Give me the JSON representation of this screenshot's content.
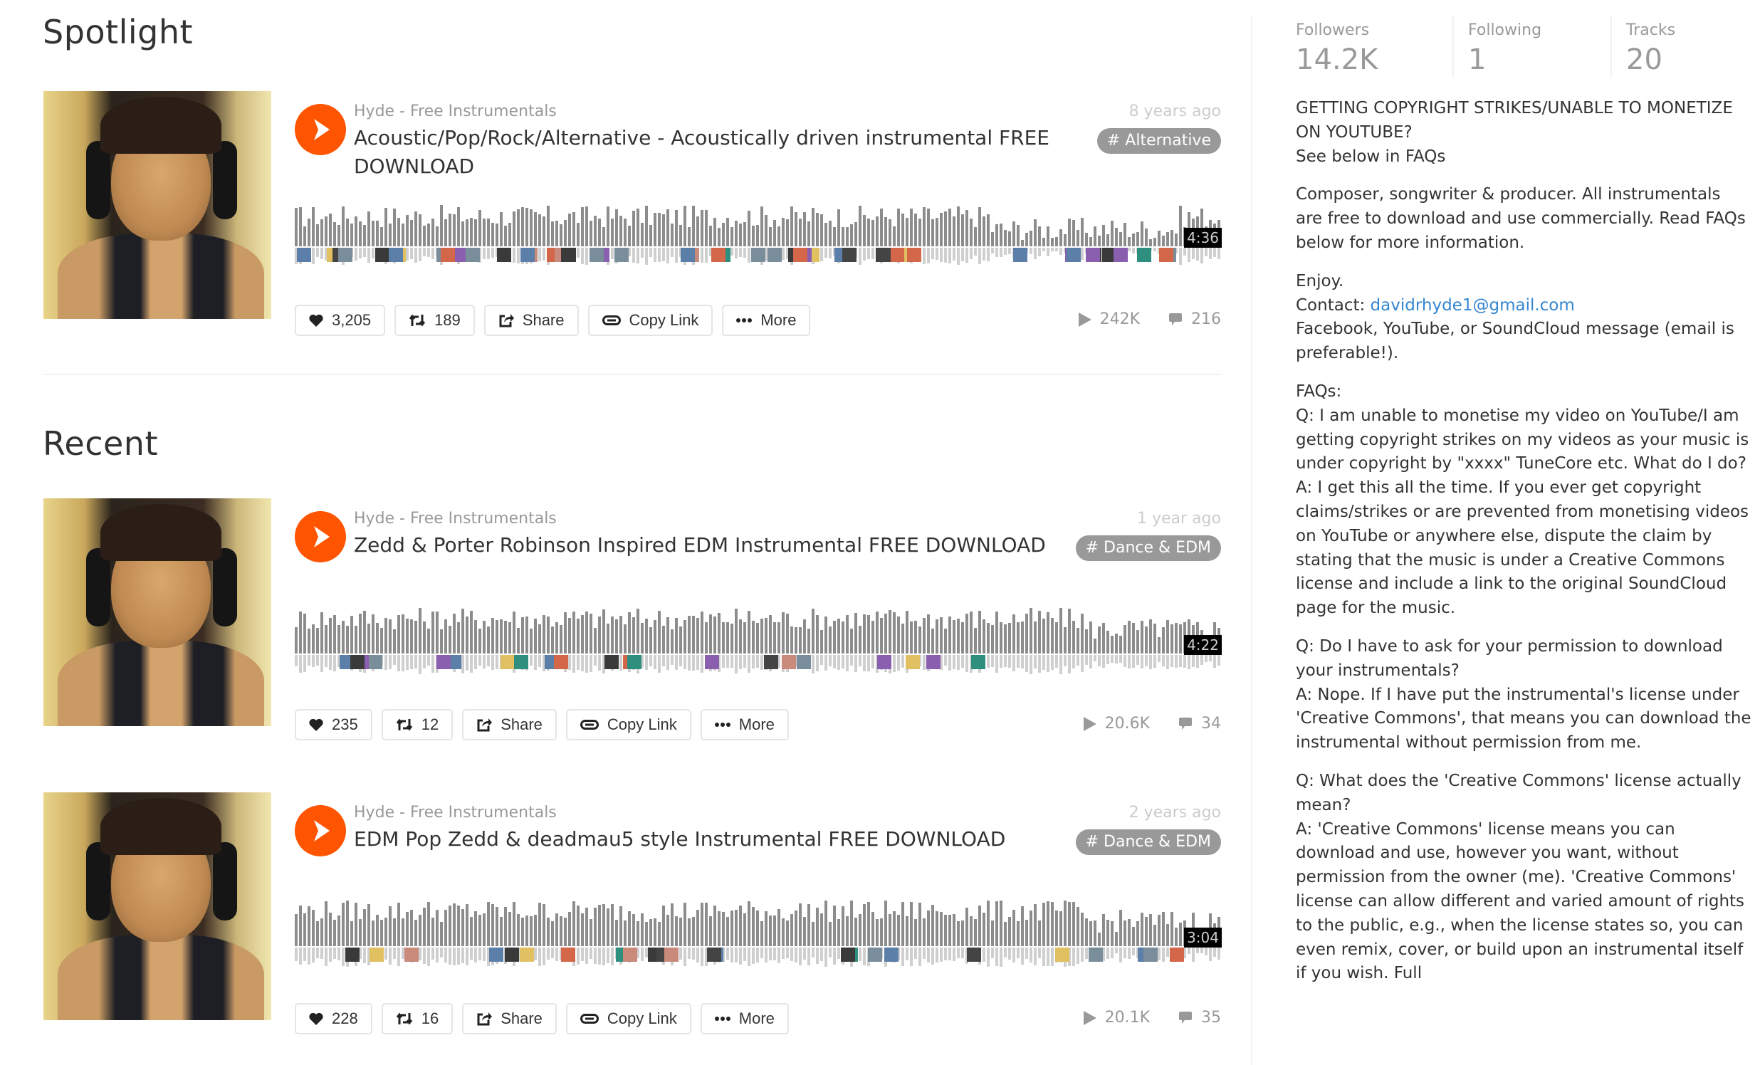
{
  "sections": {
    "spotlight_title": "Spotlight",
    "recent_title": "Recent"
  },
  "tracks": [
    {
      "user": "Hyde - Free Instrumentals",
      "title": "Acoustic/Pop/Rock/Alternative - Acoustically driven instrumental FREE DOWNLOAD",
      "age": "8 years ago",
      "tag": "# Alternative",
      "duration": "4:36",
      "likes": "3,205",
      "reposts": "189",
      "share_label": "Share",
      "copy_link_label": "Copy Link",
      "more_label": "More",
      "plays": "242K",
      "comments": "216"
    },
    {
      "user": "Hyde - Free Instrumentals",
      "title": "Zedd & Porter Robinson Inspired EDM Instrumental FREE DOWNLOAD",
      "age": "1 year ago",
      "tag": "# Dance & EDM",
      "duration": "4:22",
      "likes": "235",
      "reposts": "12",
      "share_label": "Share",
      "copy_link_label": "Copy Link",
      "more_label": "More",
      "plays": "20.6K",
      "comments": "34"
    },
    {
      "user": "Hyde - Free Instrumentals",
      "title": "EDM Pop Zedd & deadmau5 style Instrumental FREE DOWNLOAD",
      "age": "2 years ago",
      "tag": "# Dance & EDM",
      "duration": "3:04",
      "likes": "228",
      "reposts": "16",
      "share_label": "Share",
      "copy_link_label": "Copy Link",
      "more_label": "More",
      "plays": "20.1K",
      "comments": "35"
    }
  ],
  "sidebar": {
    "followers_label": "Followers",
    "followers_value": "14.2K",
    "following_label": "Following",
    "following_value": "1",
    "tracks_label": "Tracks",
    "tracks_value": "20",
    "bio": {
      "p1_l1": "GETTING COPYRIGHT STRIKES/UNABLE TO MONETIZE ON YOUTUBE?",
      "p1_l2": "See below in FAQs",
      "p2": "Composer, songwriter & producer. All instrumentals are free to download and use commercially. Read FAQs below for more information.",
      "p3_l1": "Enjoy.",
      "p3_contact_label": "Contact: ",
      "p3_email": "davidrhyde1@gmail.com",
      "p3_l3": "Facebook, YouTube, or SoundCloud message (email is preferable!).",
      "faq_heading": "FAQs:",
      "faq1_q": "Q: I am unable to monetise my video on YouTube/I am getting copyright strikes on my videos as your music is under copyright by \"xxxx\" TuneCore etc. What do I do?",
      "faq1_a": "A: I get this all the time. If you ever get copyright claims/strikes or are prevented from monetising videos on YouTube or anywhere else, dispute the claim by stating that the music is under a Creative Commons license and include a link to the original SoundCloud page for the music.",
      "faq2_q": "Q: Do I have to ask for your permission to download your instrumentals?",
      "faq2_a": "A: Nope. If I have put the instrumental's license under 'Creative Commons', that means you can download the instrumental without permission from me.",
      "faq3_q": "Q: What does the 'Creative Commons' license actually mean?",
      "faq3_a": "A: 'Creative Commons' license means you can download and use, however you want, without permission from the owner (me). 'Creative Commons' license can allow different and varied amount of rights to the public, e.g., when the license states so, you can even remix, cover, or build upon an instrumental itself if you wish. Full"
    }
  },
  "colors": {
    "accent": "#ff5500",
    "tag_bg": "#999999",
    "link": "#3486d1"
  }
}
